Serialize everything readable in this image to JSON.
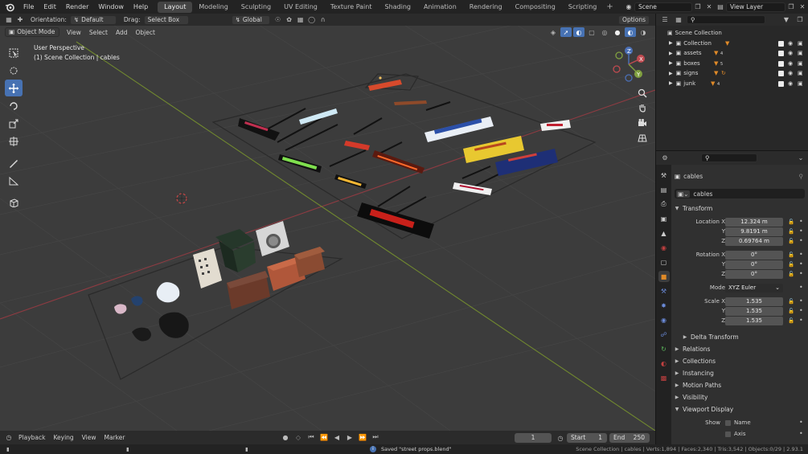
{
  "topbar": {
    "menus": [
      "File",
      "Edit",
      "Render",
      "Window",
      "Help"
    ],
    "workspaces": [
      "Layout",
      "Modeling",
      "Sculpting",
      "UV Editing",
      "Texture Paint",
      "Shading",
      "Animation",
      "Rendering",
      "Compositing",
      "Scripting"
    ],
    "active_workspace": "Layout",
    "add_tab": "+",
    "scene": "Scene",
    "view_layer": "View Layer"
  },
  "viewport": {
    "orientation_label": "Orientation:",
    "orientation_value": "Default",
    "drag_label": "Drag:",
    "drag_value": "Select Box",
    "transform_space": "Global",
    "options_label": "Options",
    "mode": "Object Mode",
    "menus": [
      "View",
      "Select",
      "Add",
      "Object"
    ],
    "info_line1": "User Perspective",
    "info_line2": "(1) Scene Collection | cables",
    "gizmo_axes": [
      "X",
      "Y",
      "Z"
    ]
  },
  "timeline": {
    "menus": [
      "Playback",
      "Keying",
      "View",
      "Marker"
    ],
    "current_frame": "1",
    "start_label": "Start",
    "start_value": "1",
    "end_label": "End",
    "end_value": "250"
  },
  "statusbar": {
    "message": "Saved \"street props.blend\"",
    "stats": "Scene Collection | cables | Verts:1,894 | Faces:2,340 | Tris:3,542 | Objects:0/29 | 2.93.1"
  },
  "outliner": {
    "root": "Scene Collection",
    "items": [
      {
        "name": "Collection",
        "badge": ""
      },
      {
        "name": "assets",
        "badge": "4"
      },
      {
        "name": "boxes",
        "badge": "5"
      },
      {
        "name": "signs",
        "badge": ""
      },
      {
        "name": "junk",
        "badge": "4"
      }
    ]
  },
  "properties": {
    "object_name": "cables",
    "data_name": "cables",
    "transform_label": "Transform",
    "location_label": "Location X",
    "location": [
      "12.324 m",
      "9.8191 m",
      "0.69764 m"
    ],
    "rotation_label": "Rotation X",
    "rotation": [
      "0°",
      "0°",
      "0°"
    ],
    "mode_label": "Mode",
    "mode_value": "XYZ Euler",
    "scale_label": "Scale X",
    "scale": [
      "1.535",
      "1.535",
      "1.535"
    ],
    "axis_y": "Y",
    "axis_z": "Z",
    "delta_transform": "Delta Transform",
    "panels": [
      "Relations",
      "Collections",
      "Instancing",
      "Motion Paths",
      "Visibility"
    ],
    "viewport_display": "Viewport Display",
    "show_label": "Show",
    "show_name": "Name",
    "show_axis": "Axis"
  }
}
